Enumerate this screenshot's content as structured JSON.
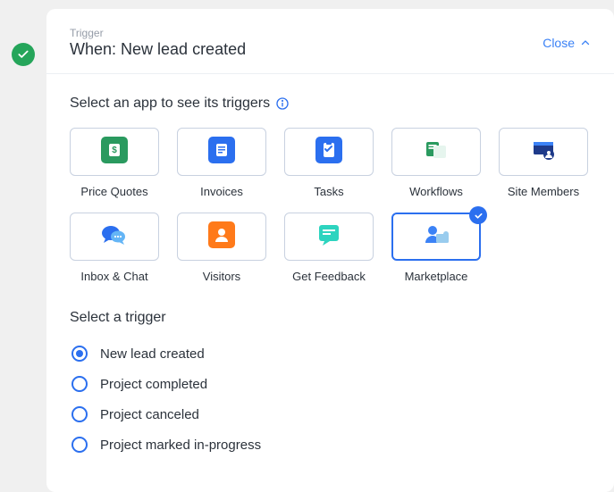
{
  "header": {
    "sub": "Trigger",
    "title": "When: New lead created",
    "close": "Close"
  },
  "section": {
    "select_app": "Select an app to see its triggers",
    "select_trigger": "Select a trigger"
  },
  "apps": [
    {
      "id": "price-quotes",
      "label": "Price Quotes"
    },
    {
      "id": "invoices",
      "label": "Invoices"
    },
    {
      "id": "tasks",
      "label": "Tasks"
    },
    {
      "id": "workflows",
      "label": "Workflows"
    },
    {
      "id": "site-members",
      "label": "Site Members"
    },
    {
      "id": "inbox-chat",
      "label": "Inbox & Chat"
    },
    {
      "id": "visitors",
      "label": "Visitors"
    },
    {
      "id": "get-feedback",
      "label": "Get Feedback"
    },
    {
      "id": "marketplace",
      "label": "Marketplace",
      "selected": true
    }
  ],
  "triggers": [
    {
      "id": "new-lead-created",
      "label": "New lead created",
      "selected": true
    },
    {
      "id": "project-completed",
      "label": "Project completed"
    },
    {
      "id": "project-canceled",
      "label": "Project canceled"
    },
    {
      "id": "project-marked-in-progress",
      "label": "Project marked in-progress"
    }
  ]
}
